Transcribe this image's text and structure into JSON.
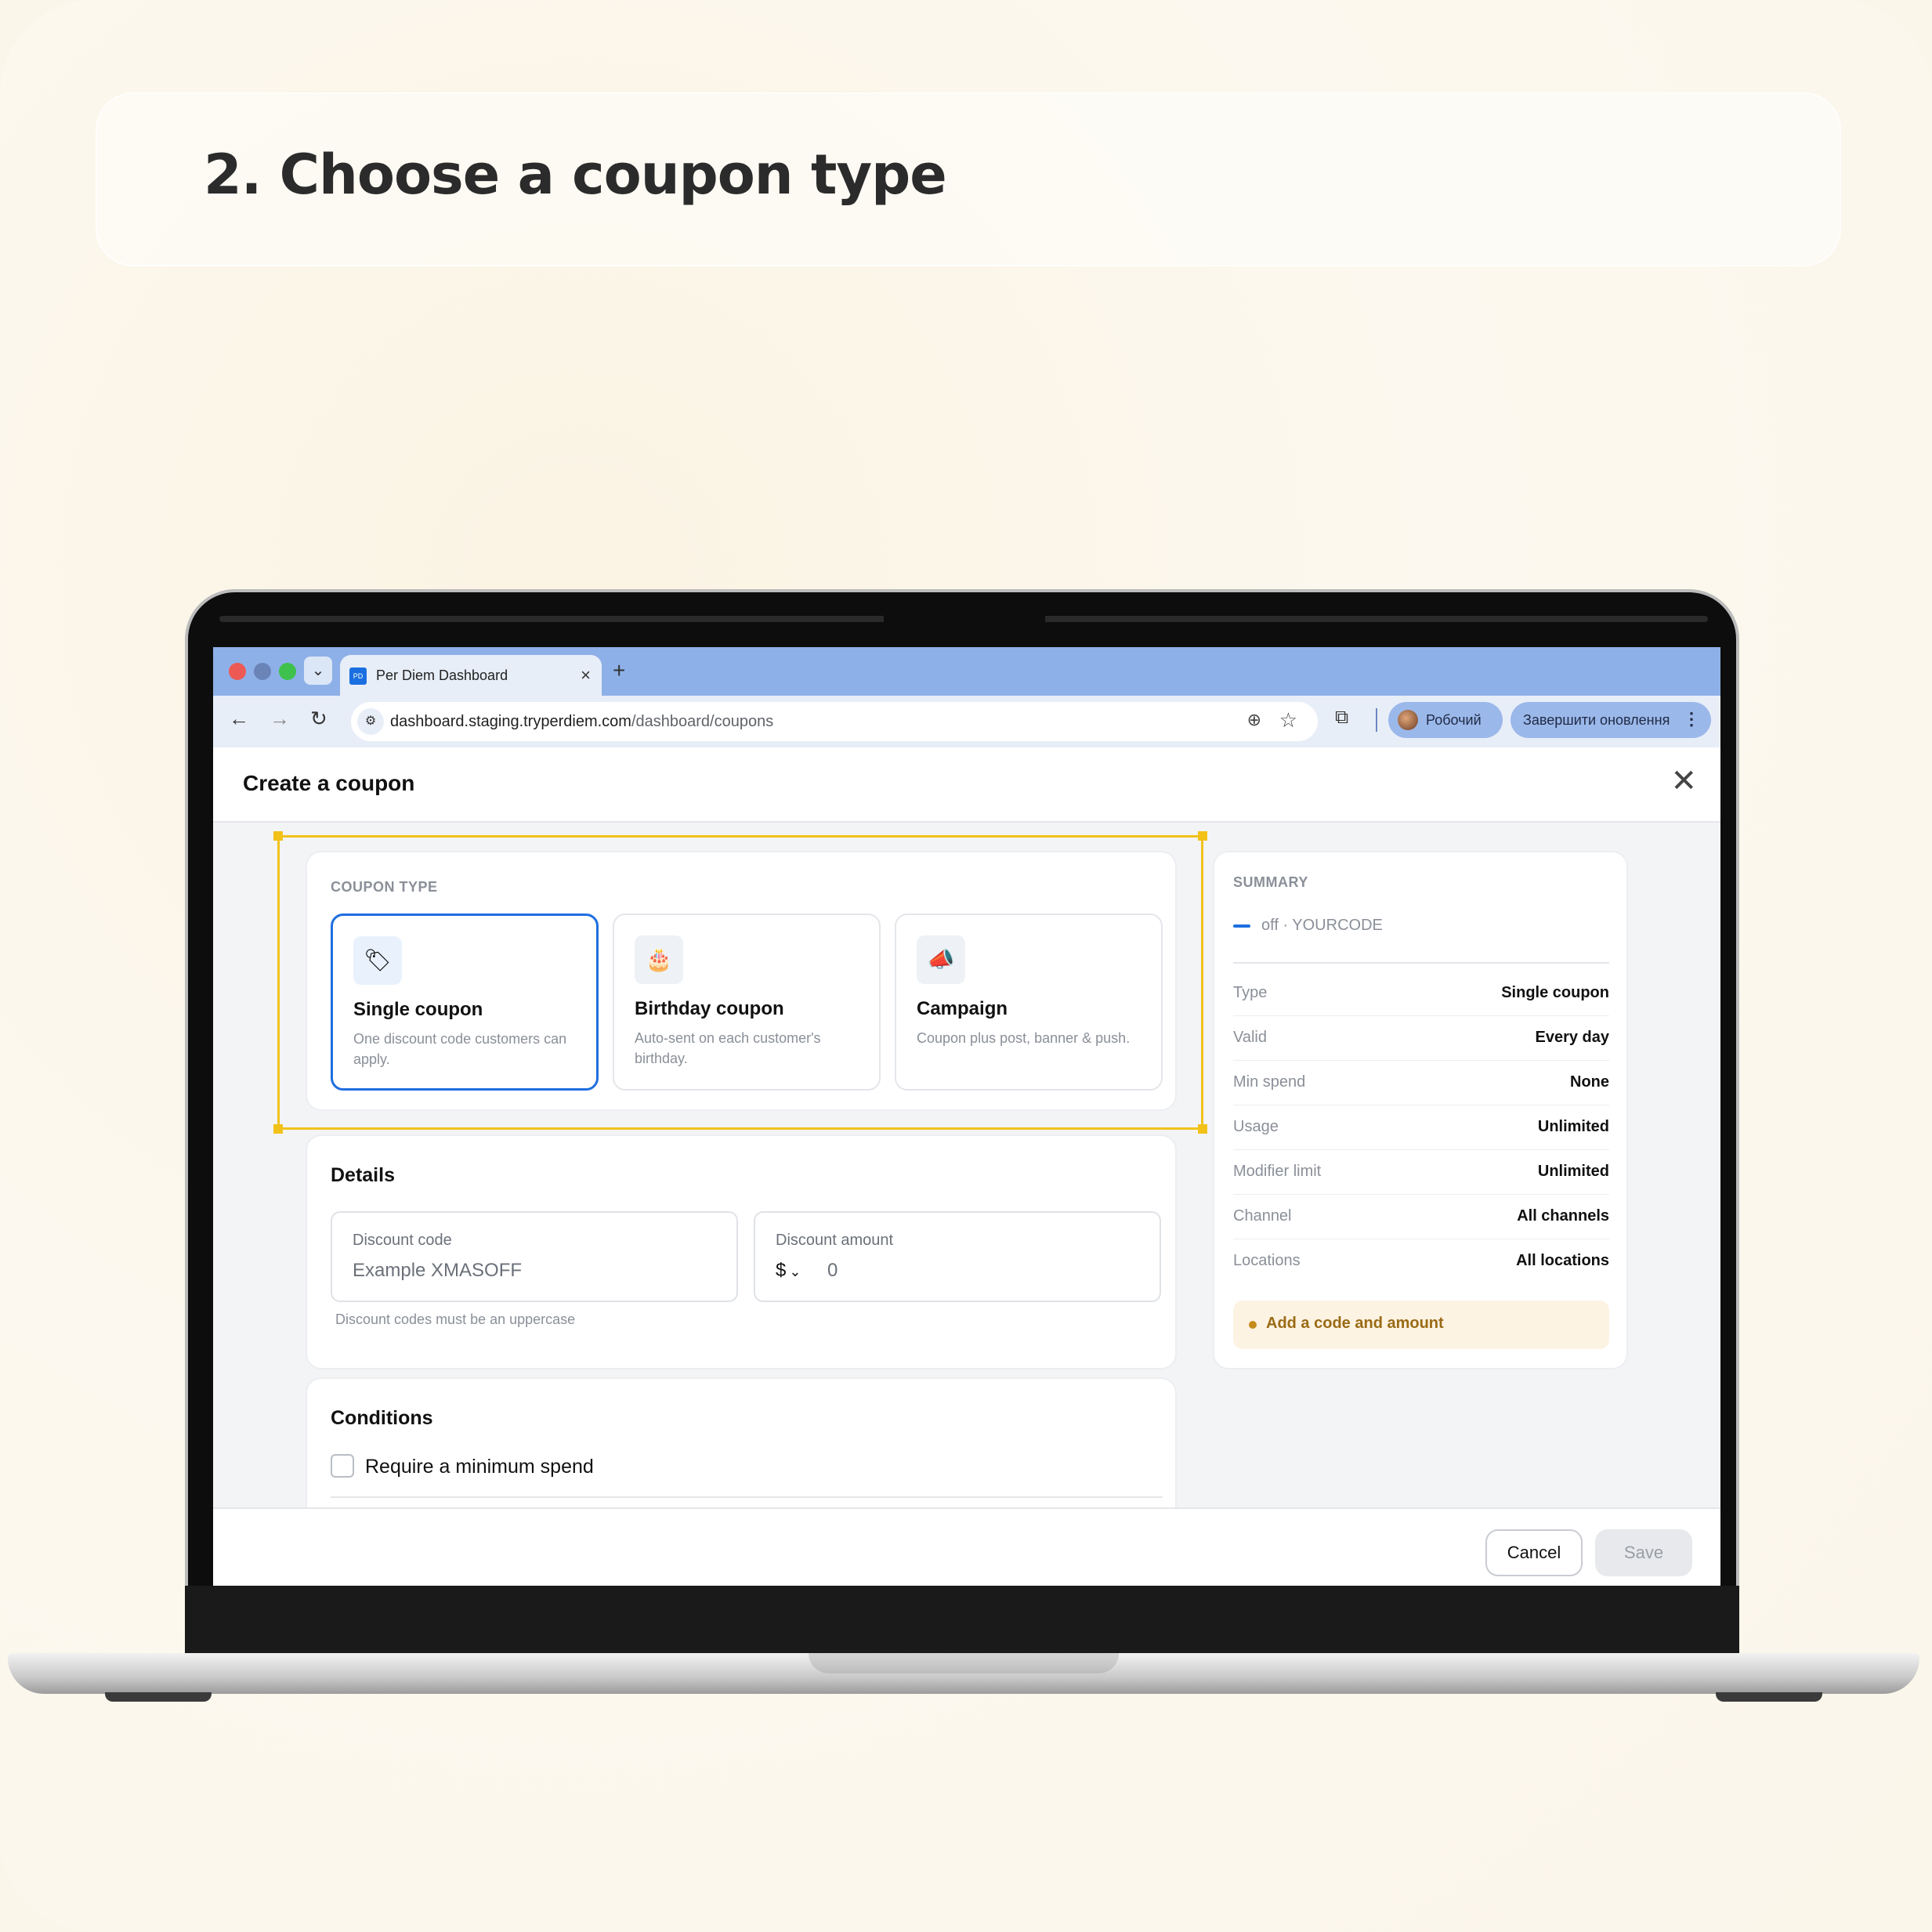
{
  "heading": "2. Choose a coupon type",
  "browser": {
    "tab_title": "Per Diem Dashboard",
    "tab_favicon_text": "PD",
    "url_host": "dashboard.staging.tryperdiem.com",
    "url_path": "/dashboard/coupons",
    "profile_label": "Робочий",
    "update_label": "Завершити оновлення"
  },
  "icons": {
    "back": "←",
    "forward": "→",
    "reload": "↻",
    "site_info": "⚙",
    "zoom": "⊕",
    "star": "☆",
    "extensions": "⧉",
    "menu": "⋮",
    "tab_close": "×",
    "new_tab": "+",
    "tab_dropdown": "⌄",
    "modal_close": "✕",
    "single_coupon": "🏷",
    "birthday": "🎂",
    "campaign": "📣",
    "currency_chevron": "⌄"
  },
  "modal": {
    "title": "Create a coupon",
    "coupon_type": {
      "label": "COUPON TYPE",
      "options": [
        {
          "name": "Single coupon",
          "description": "One discount code customers can apply.",
          "selected": true
        },
        {
          "name": "Birthday coupon",
          "description": "Auto-sent on each customer's birthday.",
          "selected": false
        },
        {
          "name": "Campaign",
          "description": "Coupon plus post, banner & push.",
          "selected": false
        }
      ]
    },
    "details": {
      "title": "Details",
      "discount_code_label": "Discount code",
      "discount_code_placeholder": "Example XMASOFF",
      "discount_code_hint": "Discount codes must be an uppercase",
      "discount_amount_label": "Discount amount",
      "currency": "$",
      "amount_placeholder": "0"
    },
    "conditions": {
      "title": "Conditions",
      "min_spend_label": "Require a minimum spend"
    },
    "summary": {
      "label": "SUMMARY",
      "code_line": "off · YOURCODE",
      "rows": [
        {
          "key": "Type",
          "value": "Single coupon"
        },
        {
          "key": "Valid",
          "value": "Every day"
        },
        {
          "key": "Min spend",
          "value": "None"
        },
        {
          "key": "Usage",
          "value": "Unlimited"
        },
        {
          "key": "Modifier limit",
          "value": "Unlimited"
        },
        {
          "key": "Channel",
          "value": "All channels"
        },
        {
          "key": "Locations",
          "value": "All locations"
        }
      ],
      "warning": "Add a code and amount"
    },
    "buttons": {
      "cancel": "Cancel",
      "save": "Save"
    }
  },
  "colors": {
    "accent": "#1f6fe0",
    "highlight": "#f2c21b",
    "warning_bg": "#fdf3e3",
    "warning_text": "#9a6a14"
  }
}
